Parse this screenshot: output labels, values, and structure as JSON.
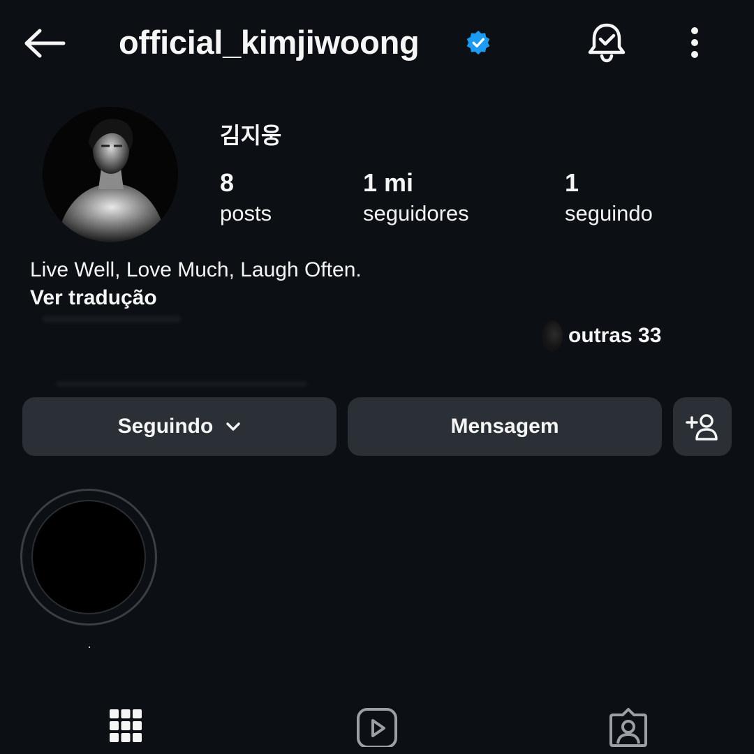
{
  "header": {
    "username": "official_kimjiwoong",
    "verified": true,
    "back_icon": "arrow-left-icon",
    "bell_icon": "bell-check-icon",
    "more_icon": "vertical-dots-icon"
  },
  "profile": {
    "display_name": "김지웅",
    "stats": {
      "posts_count": "8",
      "posts_label": "posts",
      "followers_count": "1 mi",
      "followers_label": "seguidores",
      "following_count": "1",
      "following_label": "seguindo"
    },
    "bio": "Live Well, Love Much, Laugh Often.",
    "translate_link": "Ver tradução",
    "mutual_followers_text": "outras 33"
  },
  "actions": {
    "following_label": "Seguindo",
    "message_label": "Mensagem",
    "add_person_icon": "add-person-icon"
  },
  "highlights": [
    {
      "label": "."
    }
  ],
  "tabs": {
    "grid_icon": "grid-icon",
    "reels_icon": "reels-icon",
    "tagged_icon": "tagged-icon"
  },
  "colors": {
    "background": "#0c1014",
    "button": "#2b3036",
    "verified_blue": "#1d9bf0",
    "text": "#f5f5f5"
  }
}
